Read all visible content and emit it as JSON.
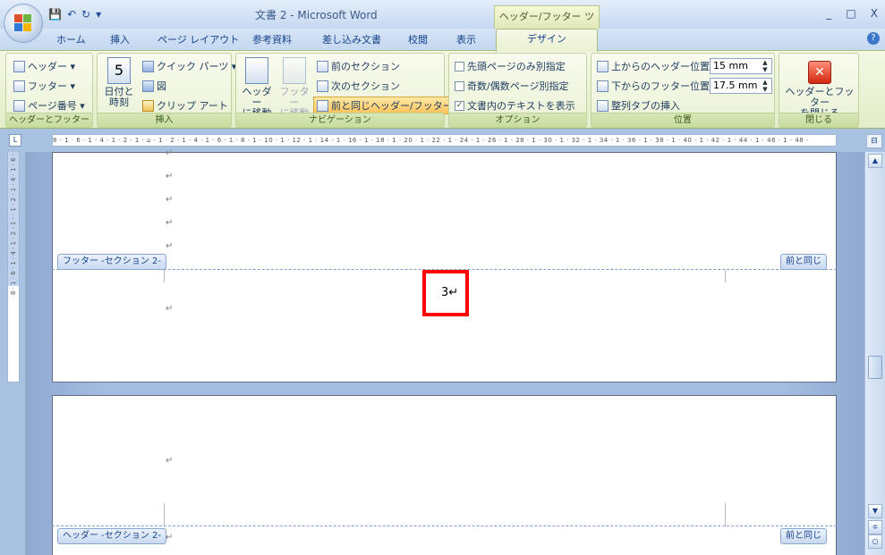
{
  "window": {
    "title": "文書 2 - Microsoft Word",
    "context_tool": "ヘッダー/フッター ツール",
    "controls": [
      "_",
      "□",
      "X"
    ]
  },
  "qat": {
    "save": "💾",
    "undo": "↶",
    "redo": "↻",
    "customize": "▾"
  },
  "tabs": [
    "ホーム",
    "挿入",
    "ページ レイアウト",
    "参考資料",
    "差し込み文書",
    "校閲",
    "表示"
  ],
  "active_tab": "デザイン",
  "help": "?",
  "ribbon": {
    "hf_group": {
      "label": "ヘッダーとフッター",
      "header": "ヘッダー ▾",
      "footer": "フッター ▾",
      "page_number": "ページ番号 ▾"
    },
    "insert_group": {
      "label": "挿入",
      "date_time": "日付と\n時刻",
      "date_number": "5",
      "quick_parts": "クイック パーツ ▾",
      "picture": "図",
      "clip_art": "クリップ アート"
    },
    "nav_group": {
      "label": "ナビゲーション",
      "goto_header": "ヘッダー\nに移動",
      "goto_footer": "フッター\nに移動",
      "prev_section": "前のセクション",
      "next_section": "次のセクション",
      "link_previous": "前と同じヘッダー/フッター"
    },
    "options_group": {
      "label": "オプション",
      "first_page": "先頭ページのみ別指定",
      "odd_even": "奇数/偶数ページ別指定",
      "show_text": "文書内のテキストを表示",
      "show_text_checked": "✓"
    },
    "position_group": {
      "label": "位置",
      "header_from_top": "上からのヘッダー位置:",
      "header_value": "15 mm",
      "footer_from_bottom": "下からのフッター位置:",
      "footer_value": "17.5 mm",
      "align_tab": "整列タブの挿入",
      "spin": "▲\n▼"
    },
    "close_group": {
      "label": "閉じる",
      "close": "ヘッダーとフッター\nを閉じる",
      "close_icon": "✕"
    }
  },
  "ruler": {
    "corner": "L",
    "horizontal": "8 · 1 · 6 · 1 · 4 · 1 · 2 · 1 · ⌂ · 1 · 2 · 1 · 4 · 1 · 6 · 1 · 8 · 1 · 10 · 1 · 12 · 1 · 14 · 1 · 16 · 1 · 18 · 1 · 20 · 1 · 22 · 1 · 24 · 1 · 26 · 1 · 28 · 1 · 30 · 1 · 32 · 1 · 34 · 1 · 36 · 1 · 38 · 1 · 40 · 1 · 42 · 1 · 44 · 1 · 46 · 1 · 48 ·",
    "vertical": "8 · 1 · 6 · 1 · 4 · 1 · 2 · 1 · · 1 · 2 · 1 · 4 · 1 · 6 ·"
  },
  "document": {
    "para_mark": "↵",
    "footer_tag": "フッター -セクション 2-",
    "header_tag": "ヘッダー -セクション 2-",
    "same_as_previous": "前と同じ",
    "page_number": "3↵"
  },
  "scroll": {
    "up": "▲",
    "down": "▼",
    "prev": "≑",
    "select": "○",
    "next": "≑"
  }
}
